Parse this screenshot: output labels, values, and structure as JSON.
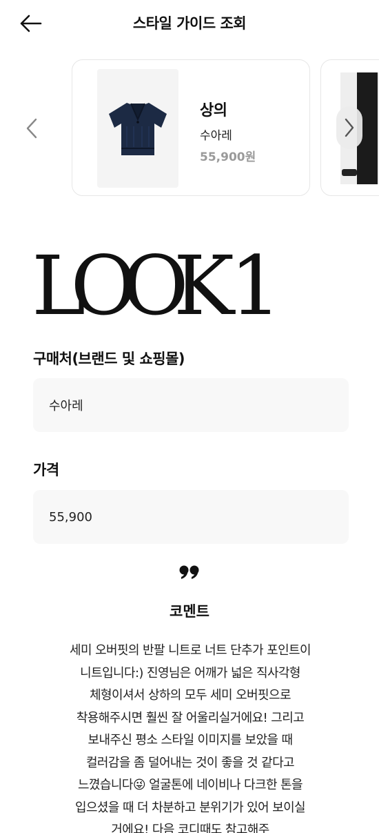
{
  "header": {
    "title": "스타일 가이드 조회"
  },
  "carousel": {
    "items": [
      {
        "category": "상의",
        "brand": "수아레",
        "price": "55,900원"
      }
    ]
  },
  "look": {
    "title": "LOOK 1"
  },
  "fields": {
    "shop_label": "구매처(브랜드 및 쇼핑몰)",
    "shop_value": "수아레",
    "price_label": "가격",
    "price_value": "55,900"
  },
  "comment": {
    "title": "코멘트",
    "body": "세미 오버핏의 반팔 니트로 너트 단추가 포인트이 니트입니다:) 진영님은 어깨가 넓은 직사각형 체형이셔서 상하의 모두 세미 오버핏으로 착용해주시면 훨씬 잘 어울리실거에요! 그리고 보내주신 평소 스타일 이미지를 보았을 때 컬러감을 좀 덜어내는 것이 좋을 것 같다고 느꼈습니다😜 얼굴톤에 네이비나 다크한 톤을 입으셨을 때 더 차분하고 분위기가 있어 보이실 거에요! 다음 코디때도 참고해주"
  },
  "icons": {
    "back": "arrow-left-icon",
    "prev": "chevron-left-icon",
    "next": "chevron-right-icon",
    "quote": "quote-icon"
  },
  "colors": {
    "field_bg": "#f8f8f8",
    "price_gray": "#9a9a9a",
    "card_border": "#e6e6e6",
    "shirt_navy": "#1c2a44"
  }
}
